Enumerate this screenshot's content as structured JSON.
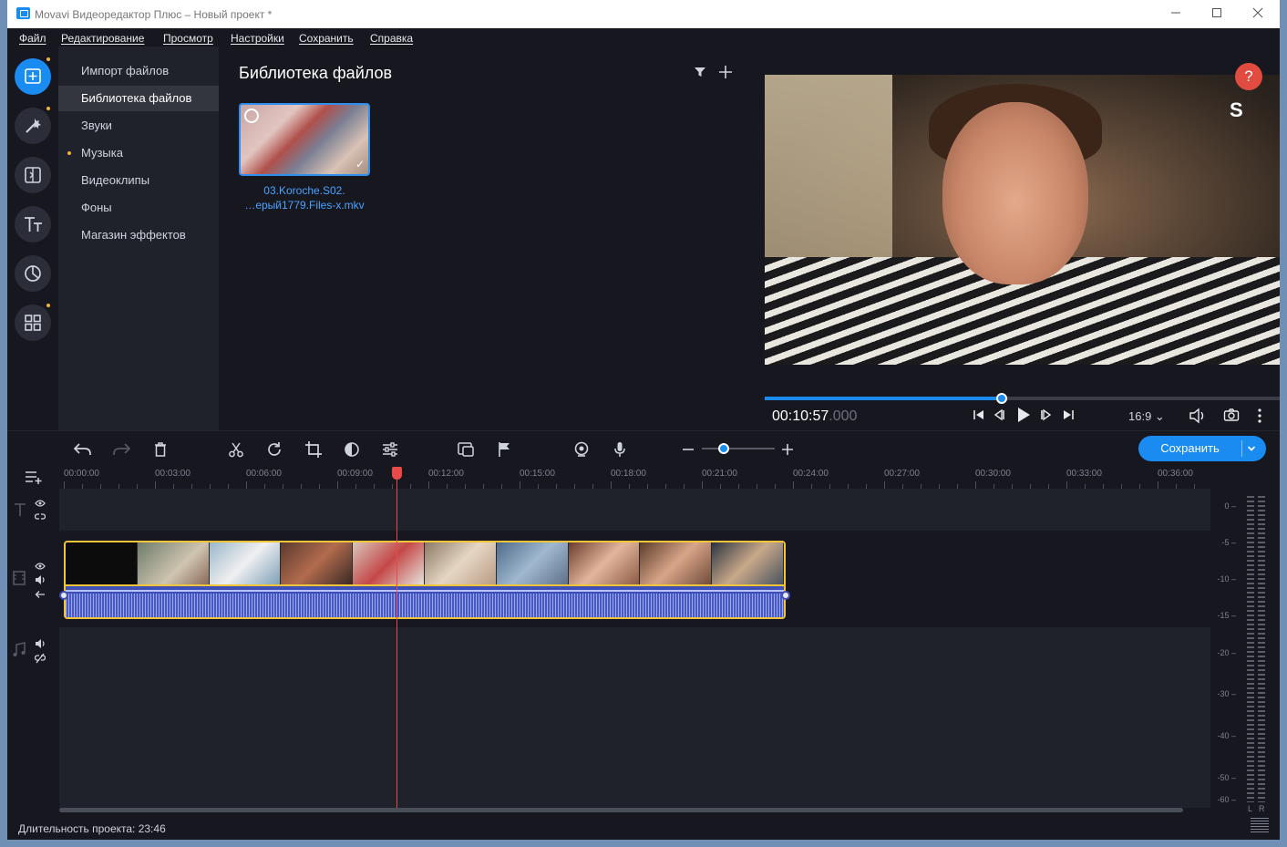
{
  "window": {
    "title": "Movavi Видеоредактор Плюс – Новый проект *",
    "controls": [
      "minimize",
      "maximize",
      "close"
    ]
  },
  "menu": [
    "Файл",
    "Редактирование",
    "Просмотр",
    "Настройки",
    "Сохранить",
    "Справка"
  ],
  "rail": [
    {
      "icon": "import-icon",
      "active": true,
      "dot": true
    },
    {
      "icon": "magic-wand-icon",
      "active": false,
      "dot": true
    },
    {
      "icon": "transitions-icon",
      "active": false,
      "dot": false
    },
    {
      "icon": "titles-icon",
      "active": false,
      "dot": false
    },
    {
      "icon": "stickers-icon",
      "active": false,
      "dot": false
    },
    {
      "icon": "more-tools-icon",
      "active": false,
      "dot": true
    }
  ],
  "categories": [
    {
      "label": "Импорт файлов",
      "active": false,
      "dot": false
    },
    {
      "label": "Библиотека файлов",
      "active": true,
      "dot": false
    },
    {
      "label": "Звуки",
      "active": false,
      "dot": false
    },
    {
      "label": "Музыка",
      "active": false,
      "dot": true
    },
    {
      "label": "Видеоклипы",
      "active": false,
      "dot": false
    },
    {
      "label": "Фоны",
      "active": false,
      "dot": false
    },
    {
      "label": "Магазин эффектов",
      "active": false,
      "dot": false
    }
  ],
  "library": {
    "title": "Библиотека файлов",
    "file": {
      "name_line1": "03.Koroche.S02.",
      "name_line2": "…ерый1779.Files-x.mkv"
    }
  },
  "preview": {
    "timecode": "00:10:57",
    "timecode_ms": ".000",
    "aspect": "16:9",
    "progress": 0.46,
    "help_label": "?",
    "watermark": "S"
  },
  "toolbar": {
    "save_label": "Сохранить",
    "zoom": 0.3
  },
  "ruler": {
    "labels": [
      "00:00:00",
      "00:03:00",
      "00:06:00",
      "00:09:00",
      "00:12:00",
      "00:15:00",
      "00:18:00",
      "00:21:00",
      "00:24:00",
      "00:27:00",
      "00:30:00",
      "00:33:00",
      "00:36:00"
    ]
  },
  "meter": {
    "labels": [
      "0",
      "-5",
      "-10",
      "-15",
      "-20",
      "-30",
      "-40",
      "-50",
      "-60"
    ],
    "channels": [
      "L",
      "R"
    ]
  },
  "status": {
    "duration_text": "Длительность проекта: 23:46"
  },
  "colors": {
    "accent": "#1a8bf0",
    "clip_border": "#f2c43a",
    "playhead": "#e84a4a",
    "dot": "#f2b33d"
  }
}
